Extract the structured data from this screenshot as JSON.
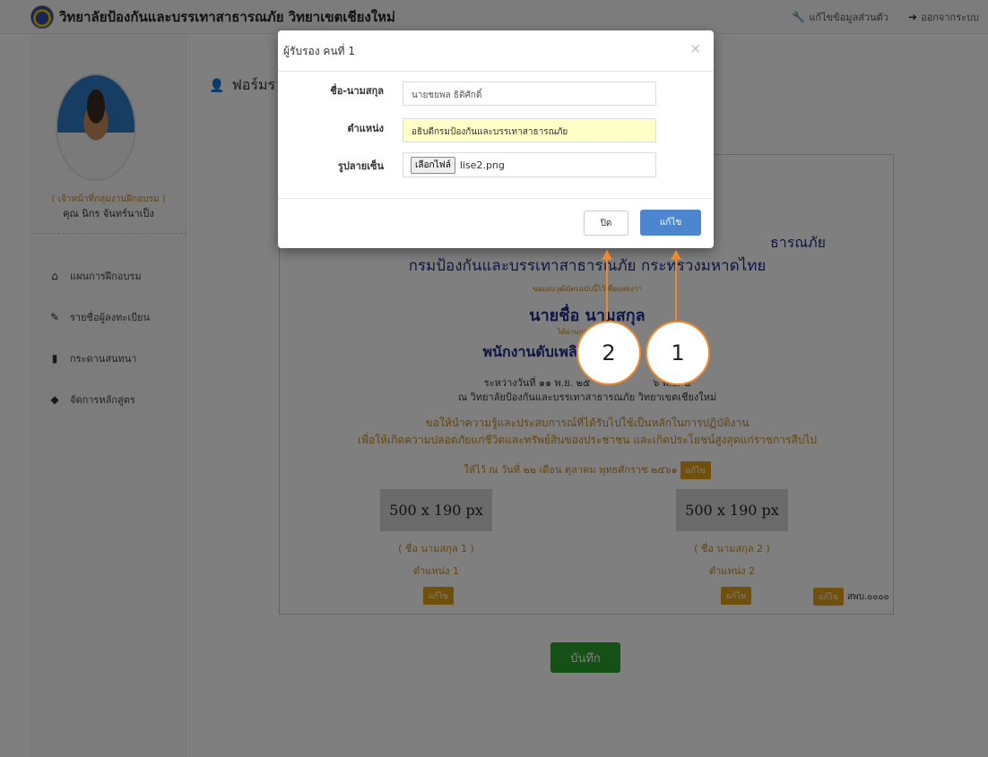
{
  "navbar": {
    "brand_title": "วิทยาลัยป้องกันและบรรเทาสาธารณภัย วิทยาเขตเชียงใหม่",
    "profile_link": "แก้ไขข้อมูลส่วนตัว",
    "logout_link": "ออกจากระบบ"
  },
  "sidebar": {
    "role": "( เจ้าหน้าที่กลุ่มงานฝึกอบรม )",
    "user_name": "คุณ นิกร จันทร์นาเป็ง",
    "menu": [
      {
        "label": "แผนการฝึกอบรม",
        "icon": "home-icon"
      },
      {
        "label": "รายชื่อผู้ลงทะเบียน",
        "icon": "pencil-icon"
      },
      {
        "label": "กระดานสนทนา",
        "icon": "bookmark-icon"
      },
      {
        "label": "จัดการหลักสูตร",
        "icon": "tag-icon"
      }
    ]
  },
  "main": {
    "heading": "ฟอร์มร",
    "save_button": "บันทึก"
  },
  "certificate": {
    "org_line1": "ธารณภัย",
    "org_line2": "กรมป้องกันและบรรเทาสาธารณภัย กระทรวงมหาดไทย",
    "given_to_label": "ขอมอบวุฒิบัตรฉบับนี้ไว้เพื่อแสดงว่า",
    "recipient": "นายชื่อ นามสกุล",
    "passed_label": "ได้ผ่านการฝึกอบรม",
    "course": "พนักงานดับเพลิง",
    "dates": "ระหว่างวันที่ ๑๑ พ.ย. ๒๕",
    "dates_end": "๖ พ.ย. ๒",
    "place": "ณ วิทยาลัยป้องกันและบรรเทาสาธารณภัย วิทยาเขตเชียงใหม่",
    "wish_line1": "ขอให้นำความรู้และประสบการณ์ที่ได้รับไปใช้เป็นหลักในการปฏิบัติงาน",
    "wish_line2": "เพื่อให้เกิดความปลอดภัยแก่ชีวิตและทรัพย์สินของประชาชน และเกิดประโยชน์สูงสุดแก่ราชการสืบไป",
    "given_date": "ให้ไว้ ณ วันที่ ๒๒ เดือน ตุลาคม พุทธศักราช ๒๕๖๑",
    "edit_label": "แก้ไข",
    "signatures": [
      {
        "placeholder": "500 x 190 px",
        "name": "( ชื่อ นามสกุล 1 )",
        "position": "ตำแหน่ง 1"
      },
      {
        "placeholder": "500 x 190 px",
        "name": "( ชื่อ นามสกุล 2 )",
        "position": "ตำแหน่ง 2"
      }
    ],
    "cert_no": "สพบ.๐๐๐๐"
  },
  "modal": {
    "title": "ผู้รับรอง คนที่ 1",
    "close_icon": "×",
    "fields": {
      "name_label": "ชื่อ-นามสกุล",
      "name_value": "นายชยพล ธิติศักดิ์",
      "position_label": "ตำแหน่ง",
      "position_value": "อธิบดีกรมป้องกันและบรรเทาสาธารณภัย",
      "signature_label": "รูปลายเซ็น",
      "file_button": "เลือกไฟล์",
      "file_name": "lise2.png"
    },
    "close_button": "ปิด",
    "save_button": "แก้ไข"
  },
  "callouts": [
    "2",
    "1"
  ],
  "colors": {
    "accent_orange": "#ee8a2e",
    "primary_blue": "#4d86cf",
    "success_green": "#2ba02b",
    "badge_yellow": "#e0a019"
  }
}
